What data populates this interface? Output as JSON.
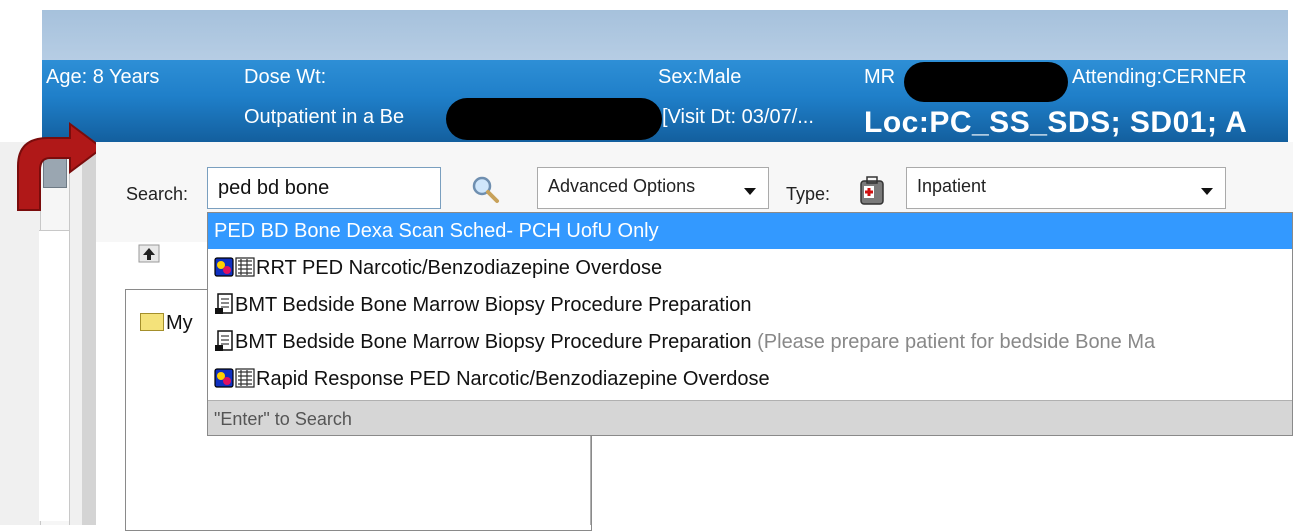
{
  "banner": {
    "age": "Age:  8 Years",
    "dose_wt": "Dose Wt:",
    "sex": "Sex:Male",
    "mrn_label": "MR",
    "attending": "Attending:CERNER",
    "encounter": "Outpatient in a Be",
    "visit_date": "[Visit Dt: 03/07/...",
    "location": "Loc:PC_SS_SDS; SD01; A"
  },
  "colors": {
    "banner_blue": "#1f7fc9",
    "selection_blue": "#3399ff",
    "arrow_red": "#b01818"
  },
  "search": {
    "label": "Search:",
    "value": "ped bd bone",
    "advanced_options": "Advanced Options",
    "type_label": "Type:",
    "type_value": "Inpatient"
  },
  "dropdown": {
    "items": [
      {
        "label": "PED BD Bone Dexa Scan Sched- PCH UofU Only",
        "hint": "",
        "icons": [],
        "selected": true
      },
      {
        "label": "RRT PED Narcotic/Benzodiazepine Overdose",
        "hint": "",
        "icons": [
          "plan-icon",
          "care-set-icon"
        ],
        "selected": false
      },
      {
        "label": "BMT Bedside Bone Marrow Biopsy Procedure Preparation",
        "hint": "",
        "icons": [
          "order-sheet-icon"
        ],
        "selected": false
      },
      {
        "label": "BMT Bedside Bone Marrow Biopsy Procedure Preparation",
        "hint": " (Please prepare patient for bedside Bone Ma",
        "icons": [
          "order-sheet-icon"
        ],
        "selected": false
      },
      {
        "label": "Rapid Response PED Narcotic/Benzodiazepine Overdose",
        "hint": "",
        "icons": [
          "plan-icon",
          "care-set-icon"
        ],
        "selected": false
      }
    ],
    "footer": "\"Enter\" to Search"
  },
  "tree": {
    "folder_label": "My"
  },
  "icons": {
    "search": "magnifier-icon",
    "type": "medical-kit-icon",
    "up": "folder-up-icon"
  }
}
